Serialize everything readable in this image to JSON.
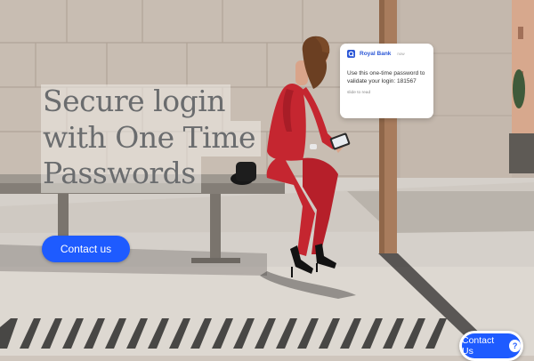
{
  "hero": {
    "headline_lines": [
      "Secure login",
      "with One Time",
      "Passwords"
    ],
    "cta_label": "Contact us",
    "background_image": "woman in red suit on bench using phone"
  },
  "notification": {
    "app_name": "Royal Bank",
    "time": "now",
    "message": "Use this one-time password to validate your login: 181567",
    "hint": "slide to read"
  },
  "chat_widget": {
    "label": "Contact Us",
    "icon": "question-icon"
  },
  "colors": {
    "accent": "#1e5bff",
    "headline": "#6a6c6e",
    "suit": "#c52630"
  }
}
